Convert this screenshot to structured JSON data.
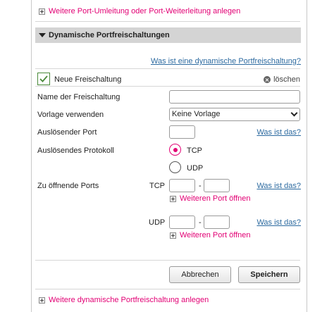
{
  "top_link": "Weitere Port-Umleitung oder Port-Weiterleitung anlegen",
  "section": {
    "title": "Dynamische Portfreischaltungen"
  },
  "help_link_dynamic": "Was ist eine dynamische Portfreischaltung?",
  "entry": {
    "checkbox_label": "Neue Freischaltung",
    "delete_label": "löschen",
    "name_label": "Name der Freischaltung",
    "name_value": "",
    "template_label": "Vorlage verwenden",
    "template_selected": "Keine Vorlage",
    "trigger_port_label": "Auslösender Port",
    "trigger_port_value": "",
    "help_link": "Was ist das?",
    "protocol_label": "Auslösendes Protokoll",
    "protocol_options": [
      "TCP",
      "UDP"
    ],
    "protocol_selected": "TCP",
    "open_ports_label": "Zu öffnende Ports",
    "tcp_label": "TCP",
    "udp_label": "UDP",
    "range_separator": "-",
    "more_port_label": "Weiteren Port öffnen"
  },
  "buttons": {
    "cancel": "Abbrechen",
    "save": "Speichern"
  },
  "bottom_link": "Weitere dynamische Portfreischaltung anlegen",
  "colors": {
    "accent": "#e20074",
    "link": "#2c6aa0",
    "check": "#4a8a3a"
  }
}
